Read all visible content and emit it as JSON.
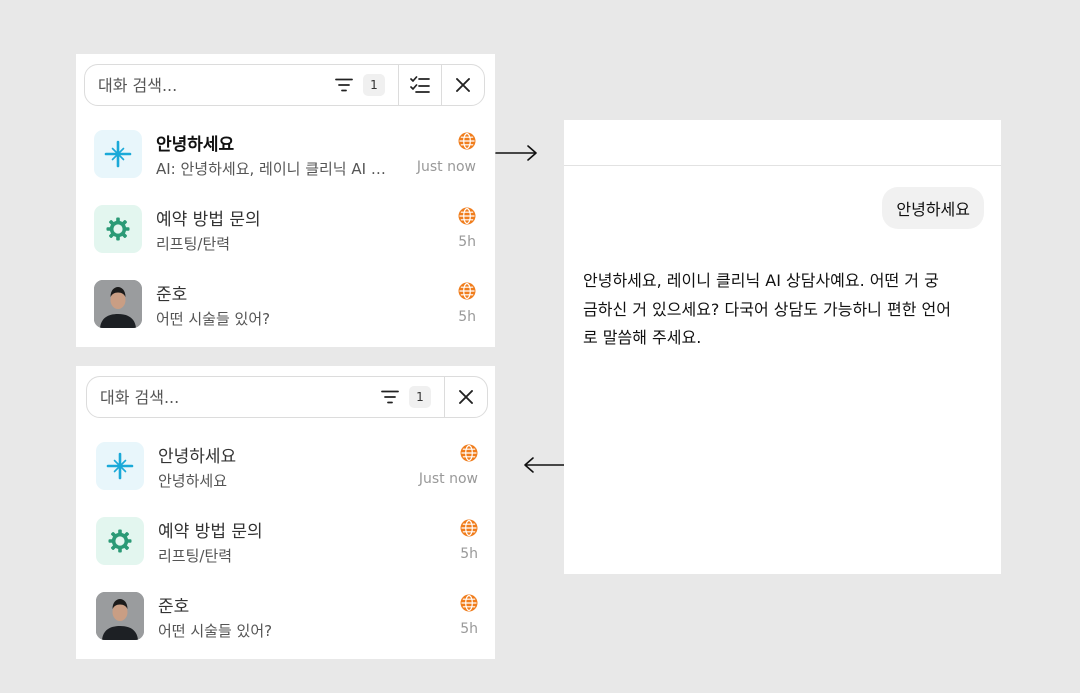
{
  "colors": {
    "accent_globe": "#f07d1c",
    "ai_icon": "#1aa9d8",
    "gear_icon": "#2b9a76",
    "panel_bg": "#ffffff",
    "page_bg": "#e8e8e8"
  },
  "list_top": {
    "search_placeholder": "대화 검색...",
    "filter_count": "1",
    "icons": [
      "filter-icon",
      "select-list-icon",
      "close-icon"
    ],
    "conversations": [
      {
        "title": "안녕하세요",
        "preview": "AI: 안녕하세요, 레이니 클리닉 AI 상담사예요. 어떤 거 궁금하신 거 있으세요?",
        "time": "Just now",
        "avatar": "ai-sparkle-icon",
        "status_icon": "globe-icon"
      },
      {
        "title": "예약 방법 문의",
        "preview": "리프팅/탄력",
        "time": "5h",
        "avatar": "gear-icon",
        "status_icon": "globe-icon"
      },
      {
        "title": "준호",
        "preview": "어떤 시술들 있어?",
        "time": "5h",
        "avatar": "user-photo",
        "status_icon": "globe-icon"
      }
    ]
  },
  "list_bottom": {
    "search_placeholder": "대화 검색...",
    "filter_count": "1",
    "icons": [
      "filter-icon",
      "close-icon"
    ],
    "conversations": [
      {
        "title": "안녕하세요",
        "preview": "안녕하세요",
        "time": "Just now",
        "avatar": "ai-sparkle-icon",
        "status_icon": "globe-icon"
      },
      {
        "title": "예약 방법 문의",
        "preview": "리프팅/탄력",
        "time": "5h",
        "avatar": "gear-icon",
        "status_icon": "globe-icon"
      },
      {
        "title": "준호",
        "preview": "어떤 시술들 있어?",
        "time": "5h",
        "avatar": "user-photo",
        "status_icon": "globe-icon"
      }
    ]
  },
  "chat": {
    "user_message": "안녕하세요",
    "ai_message": "안녕하세요, 레이니 클리닉 AI 상담사예요. 어떤 거 궁금하신 거 있으세요? 다국어 상담도 가능하니 편한 언어로 말씀해 주세요."
  }
}
